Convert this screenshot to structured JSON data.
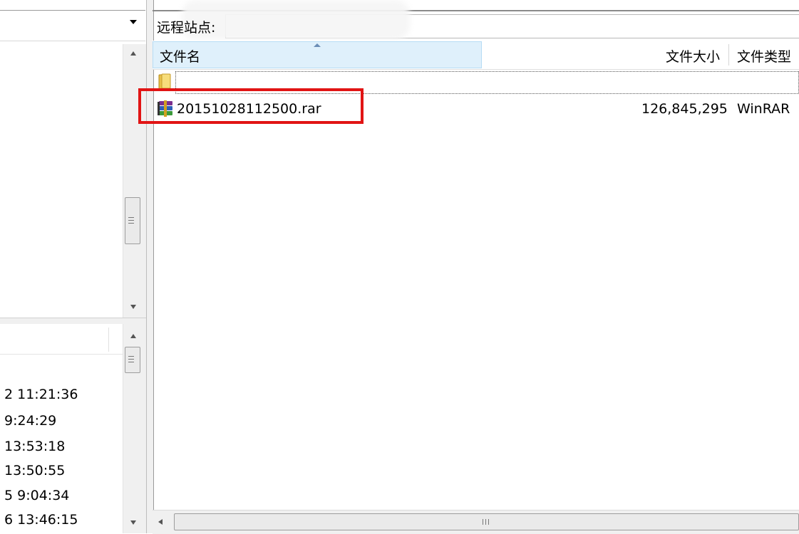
{
  "local_panel": {
    "times": [
      "2 11:21:36",
      " 9:24:29",
      " 13:53:18",
      " 13:50:55",
      "5 9:04:34",
      "6 13:46:15"
    ]
  },
  "remote_panel": {
    "site_label": "远程站点:",
    "columns": {
      "name": "文件名",
      "size": "文件大小",
      "type": "文件类型"
    },
    "files": [
      {
        "name": "20151028112500.rar",
        "size": "126,845,295",
        "type": "WinRAR"
      }
    ]
  },
  "icons": {
    "folder": "folder-icon",
    "archive": "winrar-archive-icon"
  },
  "colors": {
    "highlight_box": "#e11414",
    "header_selected": "#dff0fb"
  }
}
